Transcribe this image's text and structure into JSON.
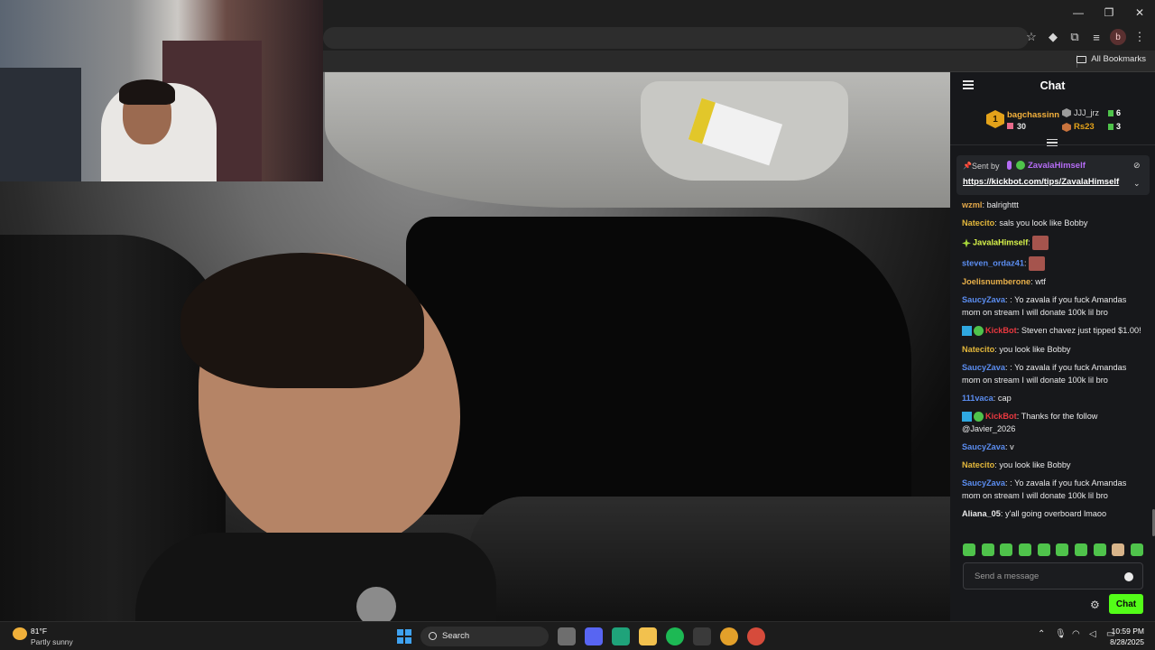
{
  "browser": {
    "bookmarks_all": "All Bookmarks",
    "profile_initial": "b"
  },
  "chat": {
    "title": "Chat",
    "leaderboard": [
      {
        "rank": "1",
        "name": "bagchassinn",
        "amount": "30"
      },
      {
        "name": "JJJ_jrz",
        "amount": "6"
      },
      {
        "name": "Rs23",
        "amount": "3"
      }
    ],
    "pinned": {
      "sent_by_label": "Sent by",
      "user": "ZavalaHimself",
      "link": "https://kickbot.com/tips/ZavalaHimself"
    },
    "messages": [
      {
        "user": "wzml",
        "user_color": "#e4a84a",
        "text": "balrighttt"
      },
      {
        "user": "Natecito",
        "user_color": "#e3b73b",
        "text": "sals you look like Bobby"
      },
      {
        "user": "JavalaHimself",
        "user_color": "#d8f34b",
        "text": "",
        "badge": "star",
        "emote": true
      },
      {
        "user": "steven_ordaz41",
        "user_color": "#5b8df0",
        "text": "",
        "emote": true
      },
      {
        "user": "Joelisnumberone",
        "user_color": "#e8b04a",
        "text": "wtf"
      },
      {
        "user": "SaucyZava",
        "user_color": "#5b8df0",
        "text": ": Yo zavala if you fuck Amandas mom on stream I will donate 100k lil bro"
      },
      {
        "user": "KickBot",
        "user_color": "#e8383f",
        "text": "Steven chavez just tipped $1.00!",
        "badge": "bot"
      },
      {
        "user": "Natecito",
        "user_color": "#e3b73b",
        "text": "you look like Bobby"
      },
      {
        "user": "SaucyZava",
        "user_color": "#5b8df0",
        "text": ": Yo zavala if you fuck Amandas mom on stream I will donate 100k lil bro"
      },
      {
        "user": "111vaca",
        "user_color": "#5b8df0",
        "text": "cap"
      },
      {
        "user": "KickBot",
        "user_color": "#e8383f",
        "text": "Thanks for the follow @Javier_2026",
        "badge": "bot"
      },
      {
        "user": "SaucyZava",
        "user_color": "#5b8df0",
        "text": "v"
      },
      {
        "user": "Natecito",
        "user_color": "#e3b73b",
        "text": "you look like Bobby"
      },
      {
        "user": "SaucyZava",
        "user_color": "#5b8df0",
        "text": ": Yo zavala if you fuck Amandas mom on stream I will donate 100k lil bro"
      },
      {
        "user": "Aliana_05",
        "user_color": "#e9e9ea",
        "text": "y'all going overboard lmaoo"
      }
    ],
    "input_placeholder": "Send a message",
    "send_label": "Chat",
    "accent": "#53fc18"
  },
  "taskbar": {
    "weather_temp": "81°F",
    "weather_desc": "Partly sunny",
    "search_label": "Search",
    "time": "10:59 PM",
    "date": "8/28/2025"
  }
}
